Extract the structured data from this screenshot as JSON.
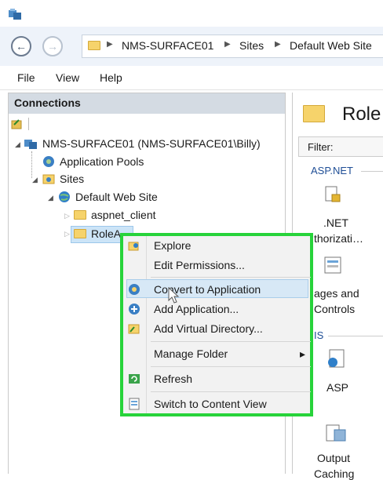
{
  "address_bar": {
    "crumbs": [
      "NMS-SURFACE01",
      "Sites",
      "Default Web Site"
    ]
  },
  "menubar": {
    "items": [
      "File",
      "View",
      "Help"
    ]
  },
  "connections": {
    "title": "Connections",
    "tree": {
      "server": "NMS-SURFACE01 (NMS-SURFACE01\\Billy)",
      "app_pools": "Application Pools",
      "sites": "Sites",
      "default_site": "Default Web Site",
      "aspnet_client": "aspnet_client",
      "role_folder": "RoleA"
    }
  },
  "right_panel": {
    "title": "Role",
    "filter_label": "Filter:",
    "group_aspnet": "ASP.NET",
    "net_auth_line1": ".NET",
    "net_auth_line2": "thorizati…",
    "pages_line1": "ages and",
    "pages_line2": "Controls",
    "group_iis": "IS",
    "asp_label": "ASP",
    "output_line1": "Output",
    "output_line2": "Caching"
  },
  "context_menu": {
    "items": [
      "Explore",
      "Edit Permissions...",
      "Convert to Application",
      "Add Application...",
      "Add Virtual Directory...",
      "Manage Folder",
      "Refresh",
      "Switch to Content View"
    ],
    "submenu_arrow": "▸",
    "highlighted": "Convert to Application"
  },
  "colors": {
    "highlight_border": "#27d33a",
    "menu_hover": "#d7e8f6"
  }
}
